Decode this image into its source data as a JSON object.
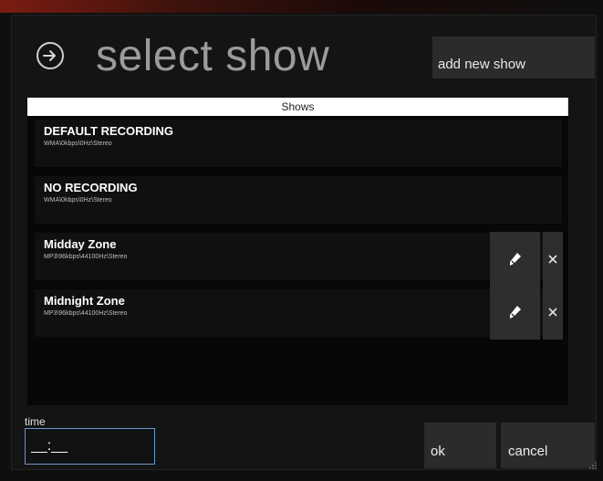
{
  "header": {
    "title": "select show",
    "back_icon": "arrow-circle-right-icon"
  },
  "toolbar": {
    "add_label": "add new show"
  },
  "list": {
    "header": "Shows",
    "items": [
      {
        "name": "DEFAULT RECORDING",
        "format": "WMA\\0kbps\\0Hz\\Stereo",
        "editable": false
      },
      {
        "name": "NO RECORDING",
        "format": "WMA\\0kbps\\0Hz\\Stereo",
        "editable": false
      },
      {
        "name": "Midday Zone",
        "format": "MP3\\96kbps\\44100Hz\\Stereo",
        "editable": true
      },
      {
        "name": "Midnight Zone",
        "format": "MP3\\96kbps\\44100Hz\\Stereo",
        "editable": true
      }
    ]
  },
  "time": {
    "label": "time",
    "placeholder": "__:__",
    "value": ""
  },
  "footer": {
    "ok_label": "ok",
    "cancel_label": "cancel"
  },
  "colors": {
    "background": "#141414",
    "accent_border": "#6a96c6",
    "title": "#9b9b9b",
    "button": "#2b2b2b"
  }
}
